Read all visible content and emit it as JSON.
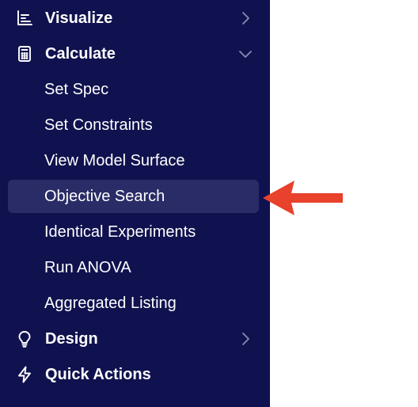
{
  "sidebar": {
    "items": [
      {
        "label": "Visualize",
        "icon": "chart-icon",
        "expanded": false
      },
      {
        "label": "Calculate",
        "icon": "calculator-icon",
        "expanded": true
      },
      {
        "label": "Design",
        "icon": "lightbulb-icon",
        "expanded": false
      },
      {
        "label": "Quick Actions",
        "icon": "lightning-icon"
      }
    ],
    "calculate_children": [
      {
        "label": "Set Spec"
      },
      {
        "label": "Set Constraints"
      },
      {
        "label": "View Model Surface"
      },
      {
        "label": "Objective Search",
        "active": true
      },
      {
        "label": "Identical Experiments"
      },
      {
        "label": "Run ANOVA"
      },
      {
        "label": "Aggregated Listing"
      }
    ]
  },
  "annotation": {
    "arrow_color": "#e8412c",
    "arrow_points_to": "Objective Search"
  },
  "colors": {
    "sidebar_bg": "#10124f",
    "active_item_bg": "#292c66",
    "text": "#ffffff",
    "chevron": "#8a8cb3"
  }
}
